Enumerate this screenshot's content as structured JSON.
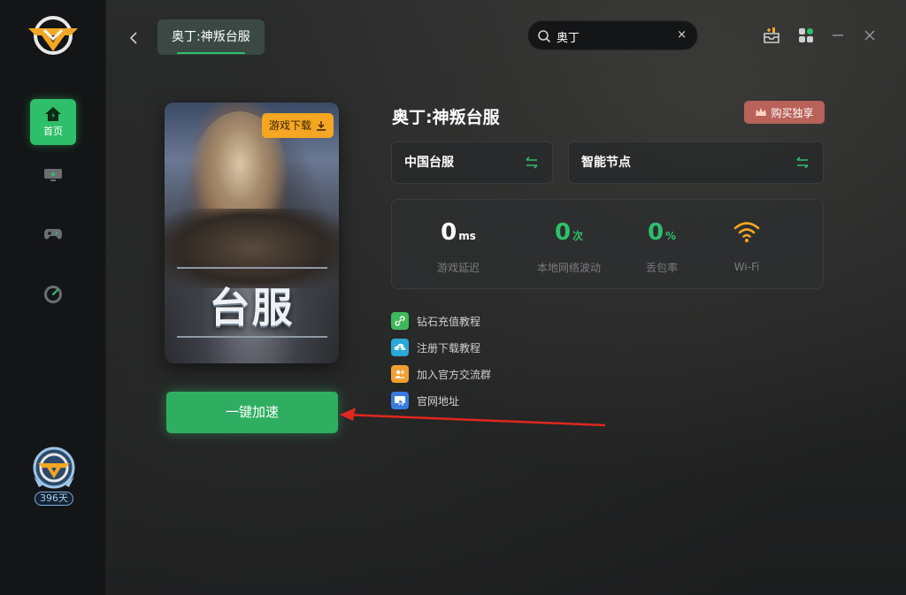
{
  "sidebar": {
    "items": [
      {
        "label": "首页",
        "icon": "home-icon",
        "active": true
      },
      {
        "label": "",
        "icon": "monitor-icon"
      },
      {
        "label": "",
        "icon": "gamepad-icon"
      },
      {
        "label": "",
        "icon": "speedometer-icon"
      }
    ],
    "user": {
      "days": "396天"
    }
  },
  "header": {
    "tab_title": "奥丁:神叛台服",
    "search": {
      "value": "奥丁",
      "clear": "×"
    }
  },
  "game": {
    "title": "奥丁:神叛台服",
    "cover_text": "台服",
    "download_label": "游戏下载",
    "buy_label": "购买独享",
    "server": "中国台服",
    "node": "智能节点",
    "accelerate_label": "一键加速"
  },
  "stats": [
    {
      "value": "0",
      "unit": "ms",
      "label": "游戏延迟",
      "color": "#ffffff"
    },
    {
      "value": "0",
      "unit": "次",
      "label": "本地网络波动",
      "color": "#2fbf6a"
    },
    {
      "value": "0",
      "unit": "%",
      "label": "丢包率",
      "color": "#2fbf6a"
    },
    {
      "value": "",
      "unit": "",
      "label": "Wi-Fi",
      "color": "#f5a623"
    }
  ],
  "links": [
    {
      "label": "钻石充值教程",
      "icon": "link-icon",
      "color": "#3fb85c"
    },
    {
      "label": "注册下载教程",
      "icon": "cloud-download-icon",
      "color": "#2aa8d8"
    },
    {
      "label": "加入官方交流群",
      "icon": "group-icon",
      "color": "#f0a030"
    },
    {
      "label": "官网地址",
      "icon": "website-icon",
      "color": "#3a7be0"
    }
  ],
  "colors": {
    "accent": "#2fbf6a",
    "buy": "#b8625a",
    "download": "#f5a623",
    "arrow": "#e0281e"
  }
}
